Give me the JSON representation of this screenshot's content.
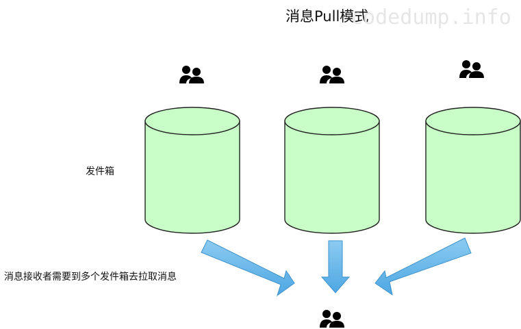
{
  "title": "消息Pull模式",
  "watermark": "codedump.info",
  "outbox_label": "发件箱",
  "receiver_caption": "消息接收者需要到多个发件箱去拉取消息",
  "icons": {
    "top": [
      "users-icon",
      "users-icon",
      "users-icon"
    ],
    "bottom": "users-icon"
  },
  "colors": {
    "cylinder_fill": "#c8fdc7",
    "cylinder_stroke": "#222222",
    "arrow_fill": "#69b8ea",
    "arrow_stroke": "#3f92cc",
    "icon": "#000000"
  }
}
